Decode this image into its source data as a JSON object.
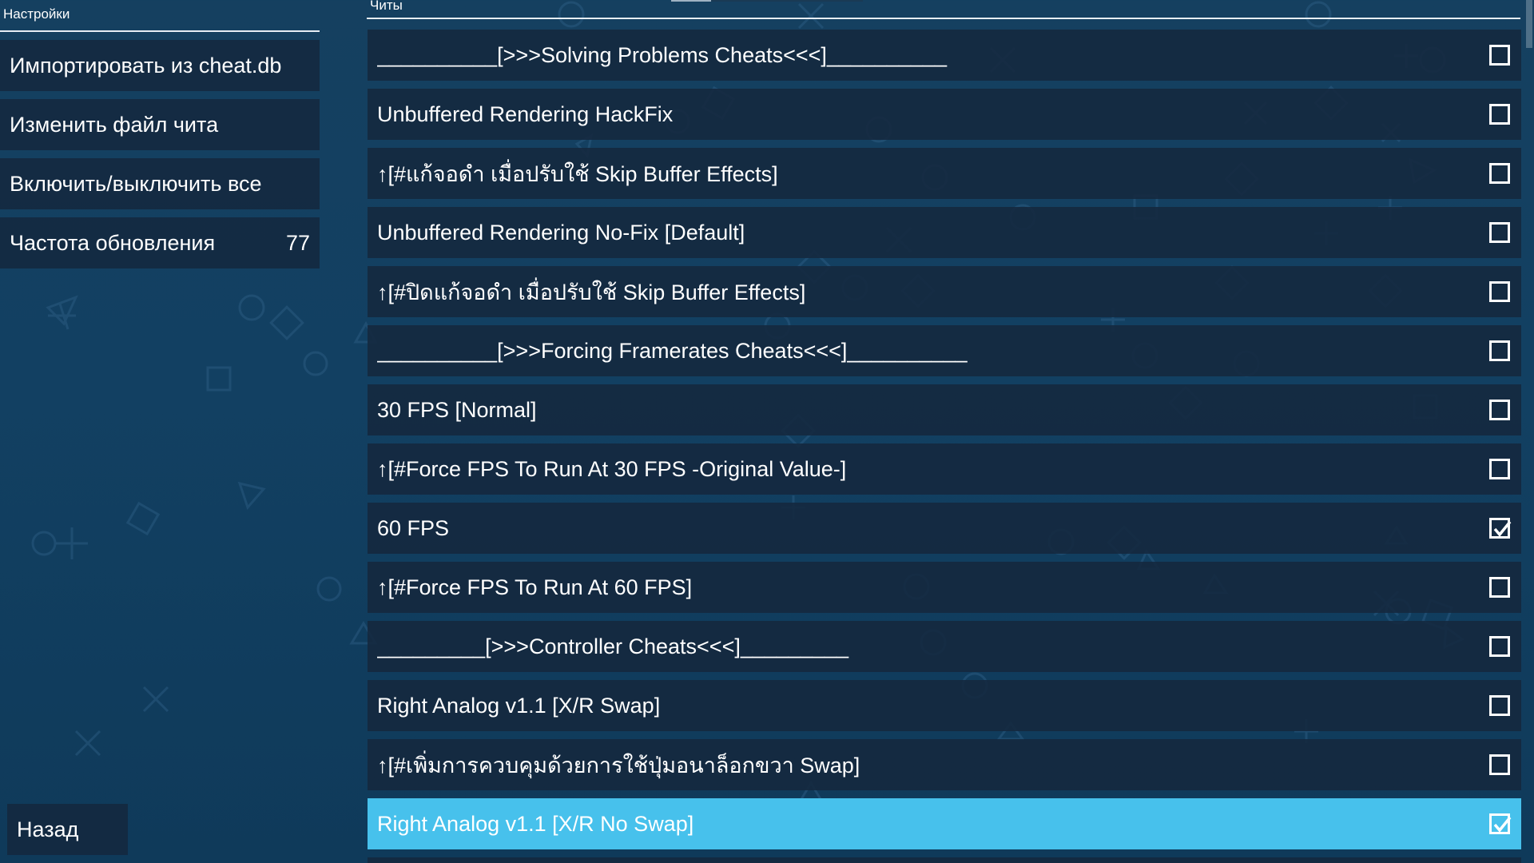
{
  "settings_panel": {
    "header": "Настройки",
    "items": [
      {
        "label": "Импортировать из cheat.db",
        "value": ""
      },
      {
        "label": "Изменить файл чита",
        "value": ""
      },
      {
        "label": "Включить/выключить все",
        "value": ""
      },
      {
        "label": "Частота обновления",
        "value": "77"
      }
    ],
    "back_label": "Назад"
  },
  "cheats_panel": {
    "header": "Читы",
    "items": [
      {
        "label": "__________[>>>Solving Problems Cheats<<<]__________",
        "checked": false,
        "selected": false
      },
      {
        "label": "Unbuffered Rendering HackFix",
        "checked": false,
        "selected": false
      },
      {
        "label": "↑[#แก้จอดำ เมื่อปรับใช้ Skip Buffer Effects]",
        "checked": false,
        "selected": false
      },
      {
        "label": "Unbuffered Rendering No-Fix [Default]",
        "checked": false,
        "selected": false
      },
      {
        "label": "↑[#ปิดแก้จอดำ เมื่อปรับใช้ Skip Buffer Effects]",
        "checked": false,
        "selected": false
      },
      {
        "label": "__________[>>>Forcing Framerates Cheats<<<]__________",
        "checked": false,
        "selected": false
      },
      {
        "label": "30 FPS [Normal]",
        "checked": false,
        "selected": false
      },
      {
        "label": "↑[#Force FPS To Run At 30 FPS -Original Value-]",
        "checked": false,
        "selected": false
      },
      {
        "label": "60 FPS",
        "checked": true,
        "selected": false
      },
      {
        "label": "↑[#Force FPS To Run At 60 FPS]",
        "checked": false,
        "selected": false
      },
      {
        "label": "_________[>>>Controller Cheats<<<]_________",
        "checked": false,
        "selected": false
      },
      {
        "label": "Right Analog v1.1 [X/R Swap]",
        "checked": false,
        "selected": false
      },
      {
        "label": "↑[#เพิ่มการควบคุมด้วยการใช้ปุ่มอนาล็อกขวา Swap]",
        "checked": false,
        "selected": false
      },
      {
        "label": "Right Analog v1.1 [X/R No Swap]",
        "checked": true,
        "selected": true
      }
    ]
  },
  "colors": {
    "background": "#134062",
    "row": "#14283e",
    "selected": "#47c1ec",
    "text": "#ffffff"
  },
  "icons": {
    "checkbox_unchecked": "checkbox-empty-icon",
    "checkbox_checked": "checkbox-checked-icon"
  }
}
